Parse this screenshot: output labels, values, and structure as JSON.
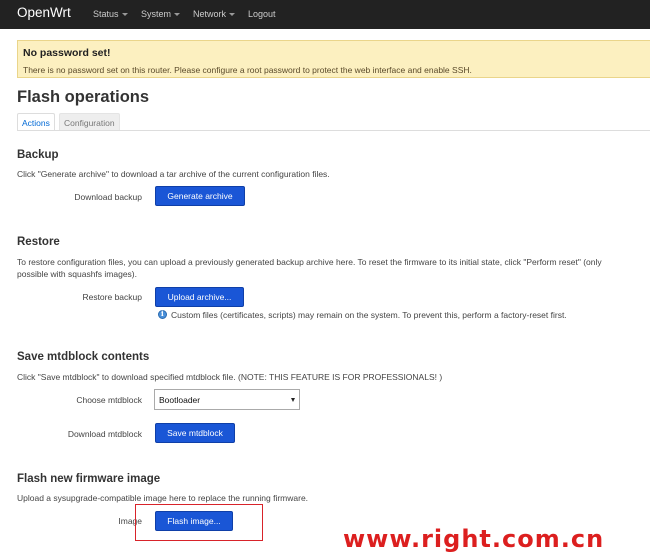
{
  "nav": {
    "brand": "OpenWrt",
    "items": [
      "Status",
      "System",
      "Network",
      "Logout"
    ]
  },
  "alert": {
    "title": "No password set!",
    "text": "There is no password set on this router. Please configure a root password to protect the web interface and enable SSH."
  },
  "page": {
    "title": "Flash operations",
    "tabs": [
      "Actions",
      "Configuration"
    ]
  },
  "backup": {
    "title": "Backup",
    "description": "Click \"Generate archive\" to download a tar archive of the current configuration files.",
    "label": "Download backup",
    "button": "Generate archive"
  },
  "restore": {
    "title": "Restore",
    "description_line1": "To restore configuration files, you can upload a previously generated backup archive here. To reset the firmware to its initial state, click \"Perform reset\" (only",
    "description_line2": "possible with squashfs images).",
    "label": "Restore backup",
    "button": "Upload archive...",
    "note": "Custom files (certificates, scripts) may remain on the system. To prevent this, perform a factory-reset first."
  },
  "mtdblock": {
    "title": "Save mtdblock contents",
    "description": "Click \"Save mtdblock\" to download specified mtdblock file. (NOTE: THIS FEATURE IS FOR PROFESSIONALS! )",
    "choose_label": "Choose mtdblock",
    "selected": "Bootloader",
    "download_label": "Download mtdblock",
    "button": "Save mtdblock"
  },
  "firmware": {
    "title": "Flash new firmware image",
    "description": "Upload a sysupgrade-compatible image here to replace the running firmware.",
    "label": "Image",
    "button": "Flash image..."
  },
  "watermark": "www.right.com.cn",
  "colors": {
    "navbar": "#222222",
    "primary_button": "#1a56d6",
    "alert_bg": "#fcf0c0",
    "highlight_border": "#d8232a",
    "watermark": "#dc1f1f"
  }
}
